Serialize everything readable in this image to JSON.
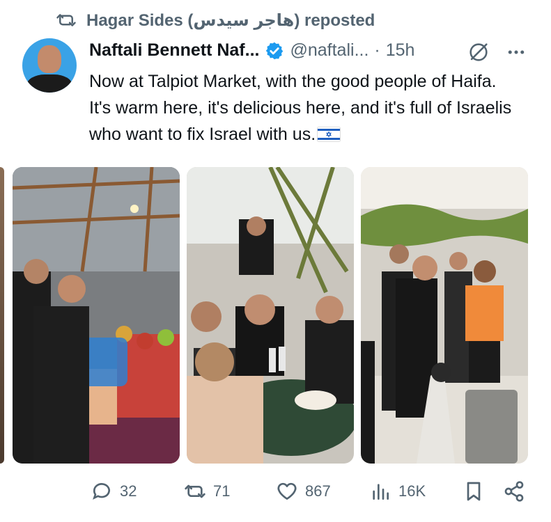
{
  "repost": {
    "text": "Hagar Sides (هاجر سيدس) reposted"
  },
  "tweet": {
    "author_name": "Naftali Bennett Naf...",
    "handle": "@naftali...",
    "separator": "·",
    "time": "15h",
    "text": "Now at Talpiot Market, with the good people of Haifa. It's warm here, it's delicious here, and it's full of Israelis who want to fix Israel with us.",
    "emoji": "israel-flag"
  },
  "media": {
    "photos": [
      {
        "name": "market-stall-photo"
      },
      {
        "name": "cafe-table-photo"
      },
      {
        "name": "cafe-crowd-photo"
      }
    ]
  },
  "actions": {
    "replies": "32",
    "reposts": "71",
    "likes": "867",
    "views": "16K"
  },
  "colors": {
    "text": "#0f1419",
    "muted": "#536471",
    "verified": "#1d9bf0"
  }
}
